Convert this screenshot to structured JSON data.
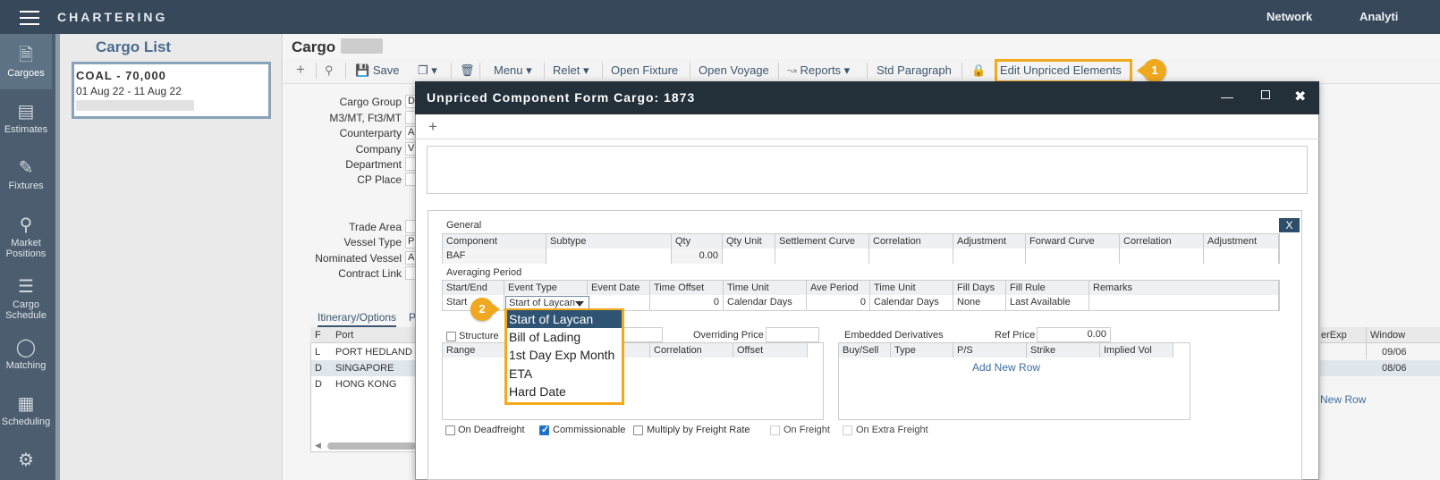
{
  "app": {
    "name": "CHARTERING"
  },
  "topnav": [
    "Network",
    "Analyti"
  ],
  "sidebar": {
    "items": [
      {
        "label": "Cargoes",
        "icon": "cargo-doc-icon"
      },
      {
        "label": "Estimates",
        "icon": "map-icon"
      },
      {
        "label": "Fixtures",
        "icon": "fixture-icon"
      },
      {
        "label": "Market Positions",
        "icon": "location-pin-icon"
      },
      {
        "label": "Cargo Schedule",
        "icon": "schedule-bars-icon"
      },
      {
        "label": "Matching",
        "icon": "globe-icon"
      },
      {
        "label": "Scheduling",
        "icon": "calendar-icon"
      }
    ]
  },
  "cargo_list": {
    "title": "Cargo List",
    "card": {
      "title": "COAL - 70,000",
      "dates": "01 Aug 22 - 11 Aug 22"
    }
  },
  "cargo": {
    "title": "Cargo",
    "toolbar": {
      "save": "Save",
      "menu": "Menu",
      "relet": "Relet",
      "open_fixture": "Open Fixture",
      "open_voyage": "Open Voyage",
      "reports": "Reports",
      "std_paragraph": "Std Paragraph",
      "edit_unpriced": "Edit Unpriced Elements"
    },
    "fields": [
      "Cargo Group",
      "M3/MT, Ft3/MT",
      "Counterparty",
      "Company",
      "Department",
      "CP Place"
    ],
    "field_stubs": [
      "D",
      "",
      "A",
      "V",
      "",
      ""
    ],
    "fields2": [
      "Trade Area",
      "Vessel Type",
      "Nominated Vessel",
      "Contract Link"
    ],
    "field2_stubs": [
      "",
      "P",
      "A",
      ""
    ],
    "itinerary": {
      "tab": "Itinerary/Options",
      "tab2": "P",
      "headers": [
        "F",
        "Port"
      ],
      "rows": [
        {
          "f": "L",
          "port": "PORT HEDLAND"
        },
        {
          "f": "D",
          "port": "SINGAPORE"
        },
        {
          "f": "D",
          "port": "HONG KONG"
        }
      ]
    },
    "right_cols": {
      "h1": "erExp",
      "h2": "Window",
      "r1": "09/06",
      "r2": "08/06",
      "new_row": "New Row"
    }
  },
  "badges": {
    "one": "1",
    "two": "2"
  },
  "modal": {
    "title": "Unpriced Component Form Cargo: 1873",
    "close_btn": "X",
    "general": {
      "label": "General",
      "headers": [
        "Component",
        "Subtype",
        "Qty",
        "Qty Unit",
        "Settlement Curve",
        "Correlation",
        "Adjustment",
        "Forward Curve",
        "Correlation",
        "Adjustment"
      ],
      "row": {
        "component": "BAF",
        "qty": "0.00"
      }
    },
    "averaging": {
      "label": "Averaging Period",
      "headers": [
        "Start/End",
        "Event Type",
        "Event Date",
        "Time Offset",
        "Time Unit",
        "Ave Period",
        "Time Unit",
        "Fill Days",
        "Fill Rule",
        "Remarks"
      ],
      "row": {
        "start_end": "Start",
        "event_type": "Start of Laycan",
        "time_offset": "0",
        "time_unit": "Calendar Days",
        "ave_period": "0",
        "time_unit2": "Calendar Days",
        "fill_days": "None",
        "fill_rule": "Last Available"
      }
    },
    "dropdown_options": [
      "Start of Laycan",
      "Bill of Lading",
      "1st Day Exp Month",
      "ETA",
      "Hard Date"
    ],
    "structure": {
      "label": "Structure",
      "overriding_price": "Overriding Price",
      "headers": [
        "Range",
        "Correlation",
        "Offset"
      ]
    },
    "embedded": {
      "label": "Embedded Derivatives",
      "ref_price_label": "Ref Price",
      "ref_price": "0.00",
      "headers": [
        "Buy/Sell",
        "Type",
        "P/S",
        "Strike",
        "Implied Vol"
      ],
      "add_row": "Add New Row"
    },
    "checks": [
      {
        "label": "On Deadfreight",
        "checked": false
      },
      {
        "label": "Commissionable",
        "checked": true
      },
      {
        "label": "Multiply by Freight Rate",
        "checked": false
      },
      {
        "label": "On Freight",
        "checked": false
      },
      {
        "label": "On Extra Freight",
        "checked": false
      }
    ]
  }
}
